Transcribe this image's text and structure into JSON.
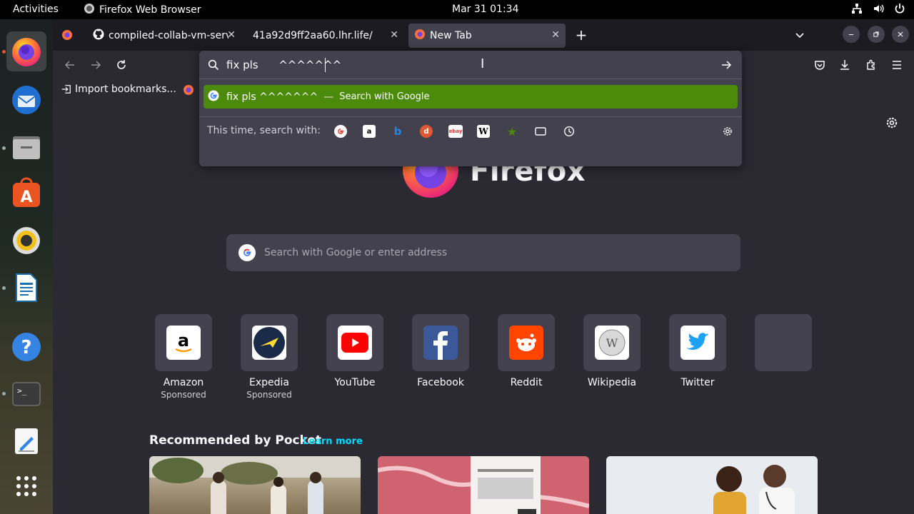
{
  "topbar": {
    "activities": "Activities",
    "app_name": "Firefox Web Browser",
    "clock": "Mar 31  01:34"
  },
  "tabs": [
    {
      "title": "compiled-collab-vm-serve",
      "icon": "github-icon"
    },
    {
      "title": "41a92d9ff2aa60.lhr.life/",
      "icon": "none"
    },
    {
      "title": "New Tab",
      "icon": "firefox-icon"
    }
  ],
  "urlbar": {
    "value": "fix pls      ^^^^^^^",
    "suggestion_text": "fix pls ^^^^^^^",
    "suggestion_dash": "—",
    "suggestion_action": "Search with Google",
    "one_offs_label": "This time, search with:"
  },
  "bookmarks": {
    "import_label": "Import bookmarks..."
  },
  "newtab": {
    "search_placeholder": "Search with Google or enter address",
    "logo_text": "Firefox",
    "top_sites": [
      {
        "label": "Amazon",
        "sponsor": "Sponsored",
        "color": "#ffffff"
      },
      {
        "label": "Expedia",
        "sponsor": "Sponsored",
        "color": "#ffffff"
      },
      {
        "label": "YouTube",
        "sponsor": "",
        "color": "#ffffff"
      },
      {
        "label": "Facebook",
        "sponsor": "",
        "color": "#3b5998"
      },
      {
        "label": "Reddit",
        "sponsor": "",
        "color": "#ff4500"
      },
      {
        "label": "Wikipedia",
        "sponsor": "",
        "color": "#ffffff"
      },
      {
        "label": "Twitter",
        "sponsor": "",
        "color": "#ffffff"
      }
    ],
    "pocket_title": "Recommended by Pocket",
    "pocket_learn_more": "Learn more"
  },
  "colors": {
    "suggestion_bg": "#4c8a0b",
    "accent": "#00ddff",
    "ubuntu_orange": "#e95420"
  }
}
